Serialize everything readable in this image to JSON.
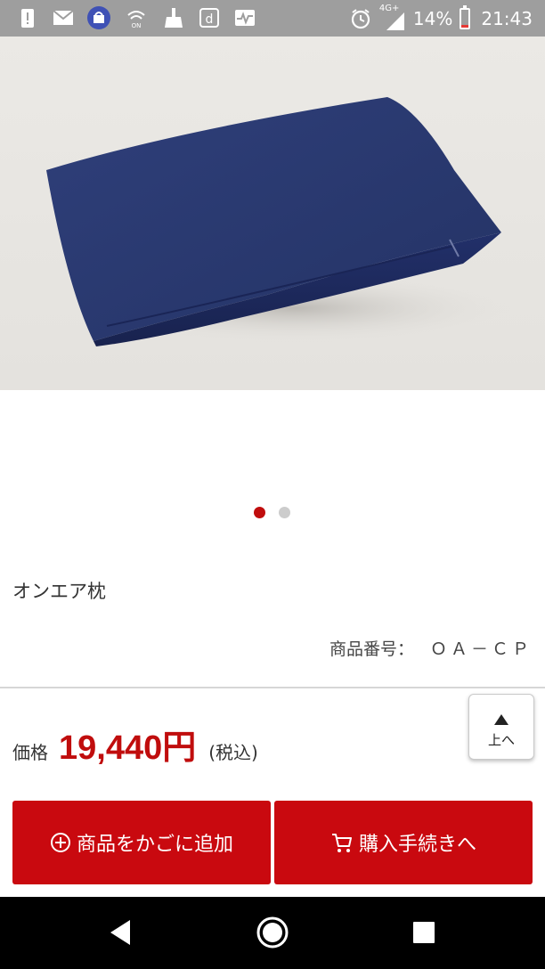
{
  "status_bar": {
    "left_icons": [
      "alert-icon",
      "gmail-icon",
      "store-app-icon",
      "wifi-call-icon",
      "cleaner-icon",
      "d-menu-icon",
      "monitor-icon"
    ],
    "network": "4G+",
    "battery": "14%",
    "time": "21:43",
    "battery_color": "#e53935"
  },
  "product": {
    "name": "オンエア枕",
    "code_label": "商品番号：",
    "code_value": "ＯＡ－ＣＰ",
    "image_index": 1,
    "image_count": 2
  },
  "price": {
    "label": "価格",
    "value": "19,440円",
    "tax_note": "(税込)"
  },
  "to_top": {
    "label": "上へ"
  },
  "actions": {
    "add_to_cart": "商品をかごに追加",
    "checkout": "購入手続きへ"
  },
  "colors": {
    "accent": "#c00d0d",
    "button": "#c9090f",
    "status_bar": "#9e9e9e"
  },
  "nav_bar": {
    "icons": [
      "back-icon",
      "home-icon",
      "recents-icon"
    ]
  }
}
